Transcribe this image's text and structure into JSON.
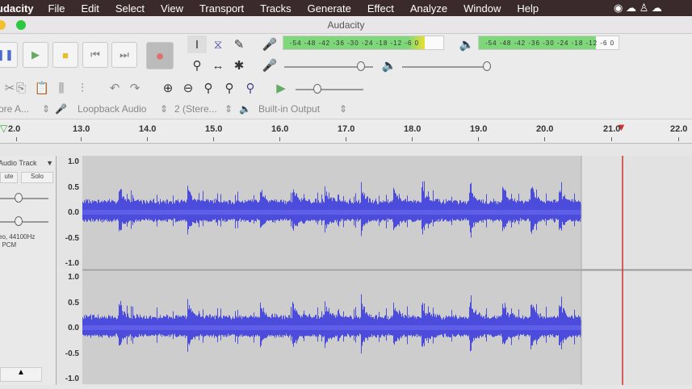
{
  "menubar": {
    "app": "udacity",
    "items": [
      "File",
      "Edit",
      "Select",
      "View",
      "Transport",
      "Tracks",
      "Generate",
      "Effect",
      "Analyze",
      "Window",
      "Help"
    ]
  },
  "window": {
    "title": "Audacity"
  },
  "meters": {
    "record_scale": "-54 -48 -42 -36 -30 -24 -18 -12 -6 0",
    "play_scale": "-54 -48 -42 -36 -30 -24 -18 -12 -6 0"
  },
  "devices": {
    "host": "ore A...",
    "input": "Loopback Audio",
    "channels": "2 (Stere...",
    "output": "Built-in Output"
  },
  "ruler": {
    "labels": [
      "2.0",
      "13.0",
      "14.0",
      "15.0",
      "16.0",
      "17.0",
      "18.0",
      "19.0",
      "20.0",
      "21.0",
      "22.0"
    ]
  },
  "track": {
    "name": "Audio Track",
    "mute": "ute",
    "solo": "Solo",
    "info1": "eo, 44100Hz",
    "info2": "t PCM",
    "scale": [
      "1.0",
      "0.5",
      "0.0",
      "-0.5",
      "-1.0"
    ]
  },
  "colors": {
    "waveform": "#4b4bdc",
    "playhead": "#d03030",
    "menubar": "#3b2a2c",
    "meter": "#7ed87a"
  }
}
